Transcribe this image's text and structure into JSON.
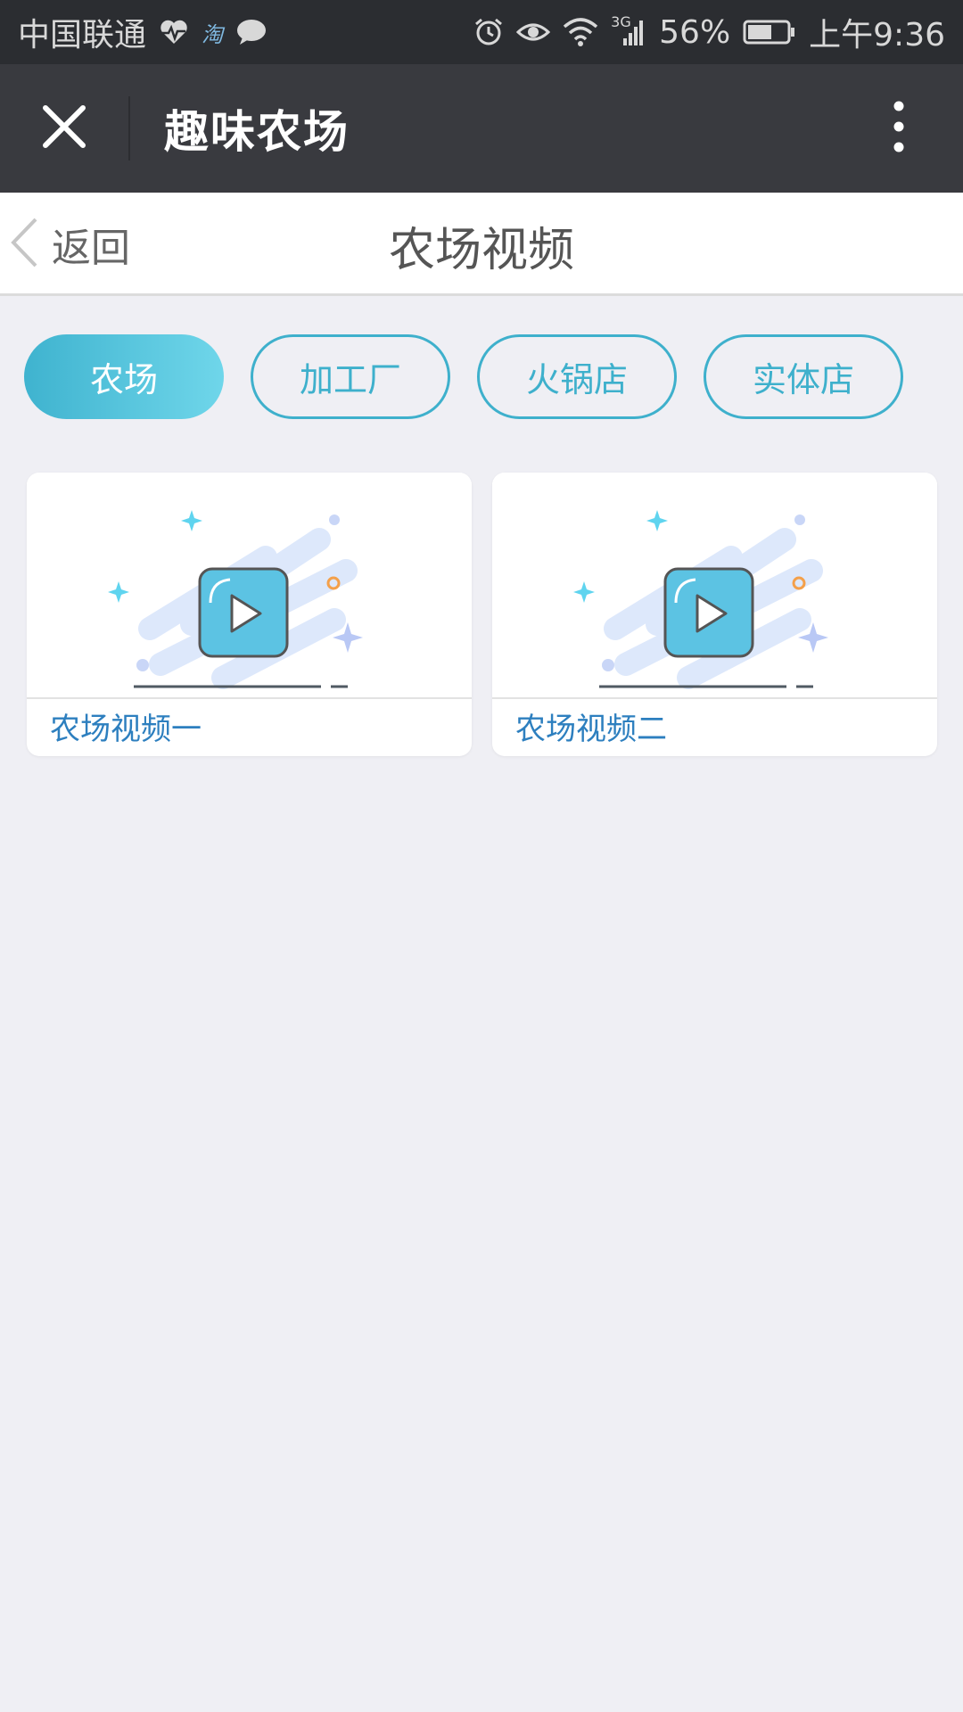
{
  "status_bar": {
    "carrier": "中国联通",
    "taobao_icon_text": "淘",
    "network": "3G",
    "battery": "56%",
    "time": "上午9:36",
    "icons": [
      "heart-rate-icon",
      "taobao-icon",
      "chat-bubble-icon",
      "alarm-icon",
      "eye-icon",
      "wifi-icon",
      "signal-icon",
      "battery-icon"
    ]
  },
  "title_bar": {
    "title": "趣味农场",
    "icons": [
      "close-icon",
      "more-vertical-icon"
    ]
  },
  "nav_bar": {
    "back_label": "返回",
    "page_title": "农场视频",
    "icons": [
      "chevron-left-icon"
    ]
  },
  "tabs": [
    {
      "label": "农场",
      "active": true
    },
    {
      "label": "加工厂",
      "active": false
    },
    {
      "label": "火锅店",
      "active": false
    },
    {
      "label": "实体店",
      "active": false
    }
  ],
  "videos": [
    {
      "title": "农场视频一",
      "thumbnail_icon": "video-play-illustration"
    },
    {
      "title": "农场视频二",
      "thumbnail_icon": "video-play-illustration"
    }
  ],
  "colors": {
    "status_bar_bg": "#2b2d31",
    "title_bar_bg": "#393a3f",
    "accent": "#3eb0cc",
    "page_bg": "#efeff4",
    "video_title": "#2d7fbf"
  }
}
